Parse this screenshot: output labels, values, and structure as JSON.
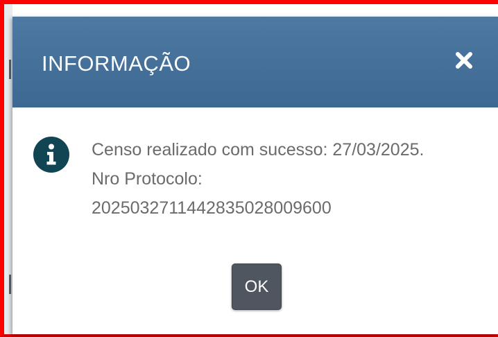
{
  "dialog": {
    "title": "INFORMAÇÃO",
    "close_icon": "close-icon",
    "info_icon": "info-icon",
    "message": {
      "line1": "Censo realizado com sucesso: 27/03/2025.",
      "line2": "Nro Protocolo:",
      "line3": "20250327114428350280096​00"
    },
    "ok_label": "OK"
  },
  "colors": {
    "header": "#3f6a94",
    "icon": "#124553",
    "button": "#505660",
    "frame": "#ff0000"
  }
}
